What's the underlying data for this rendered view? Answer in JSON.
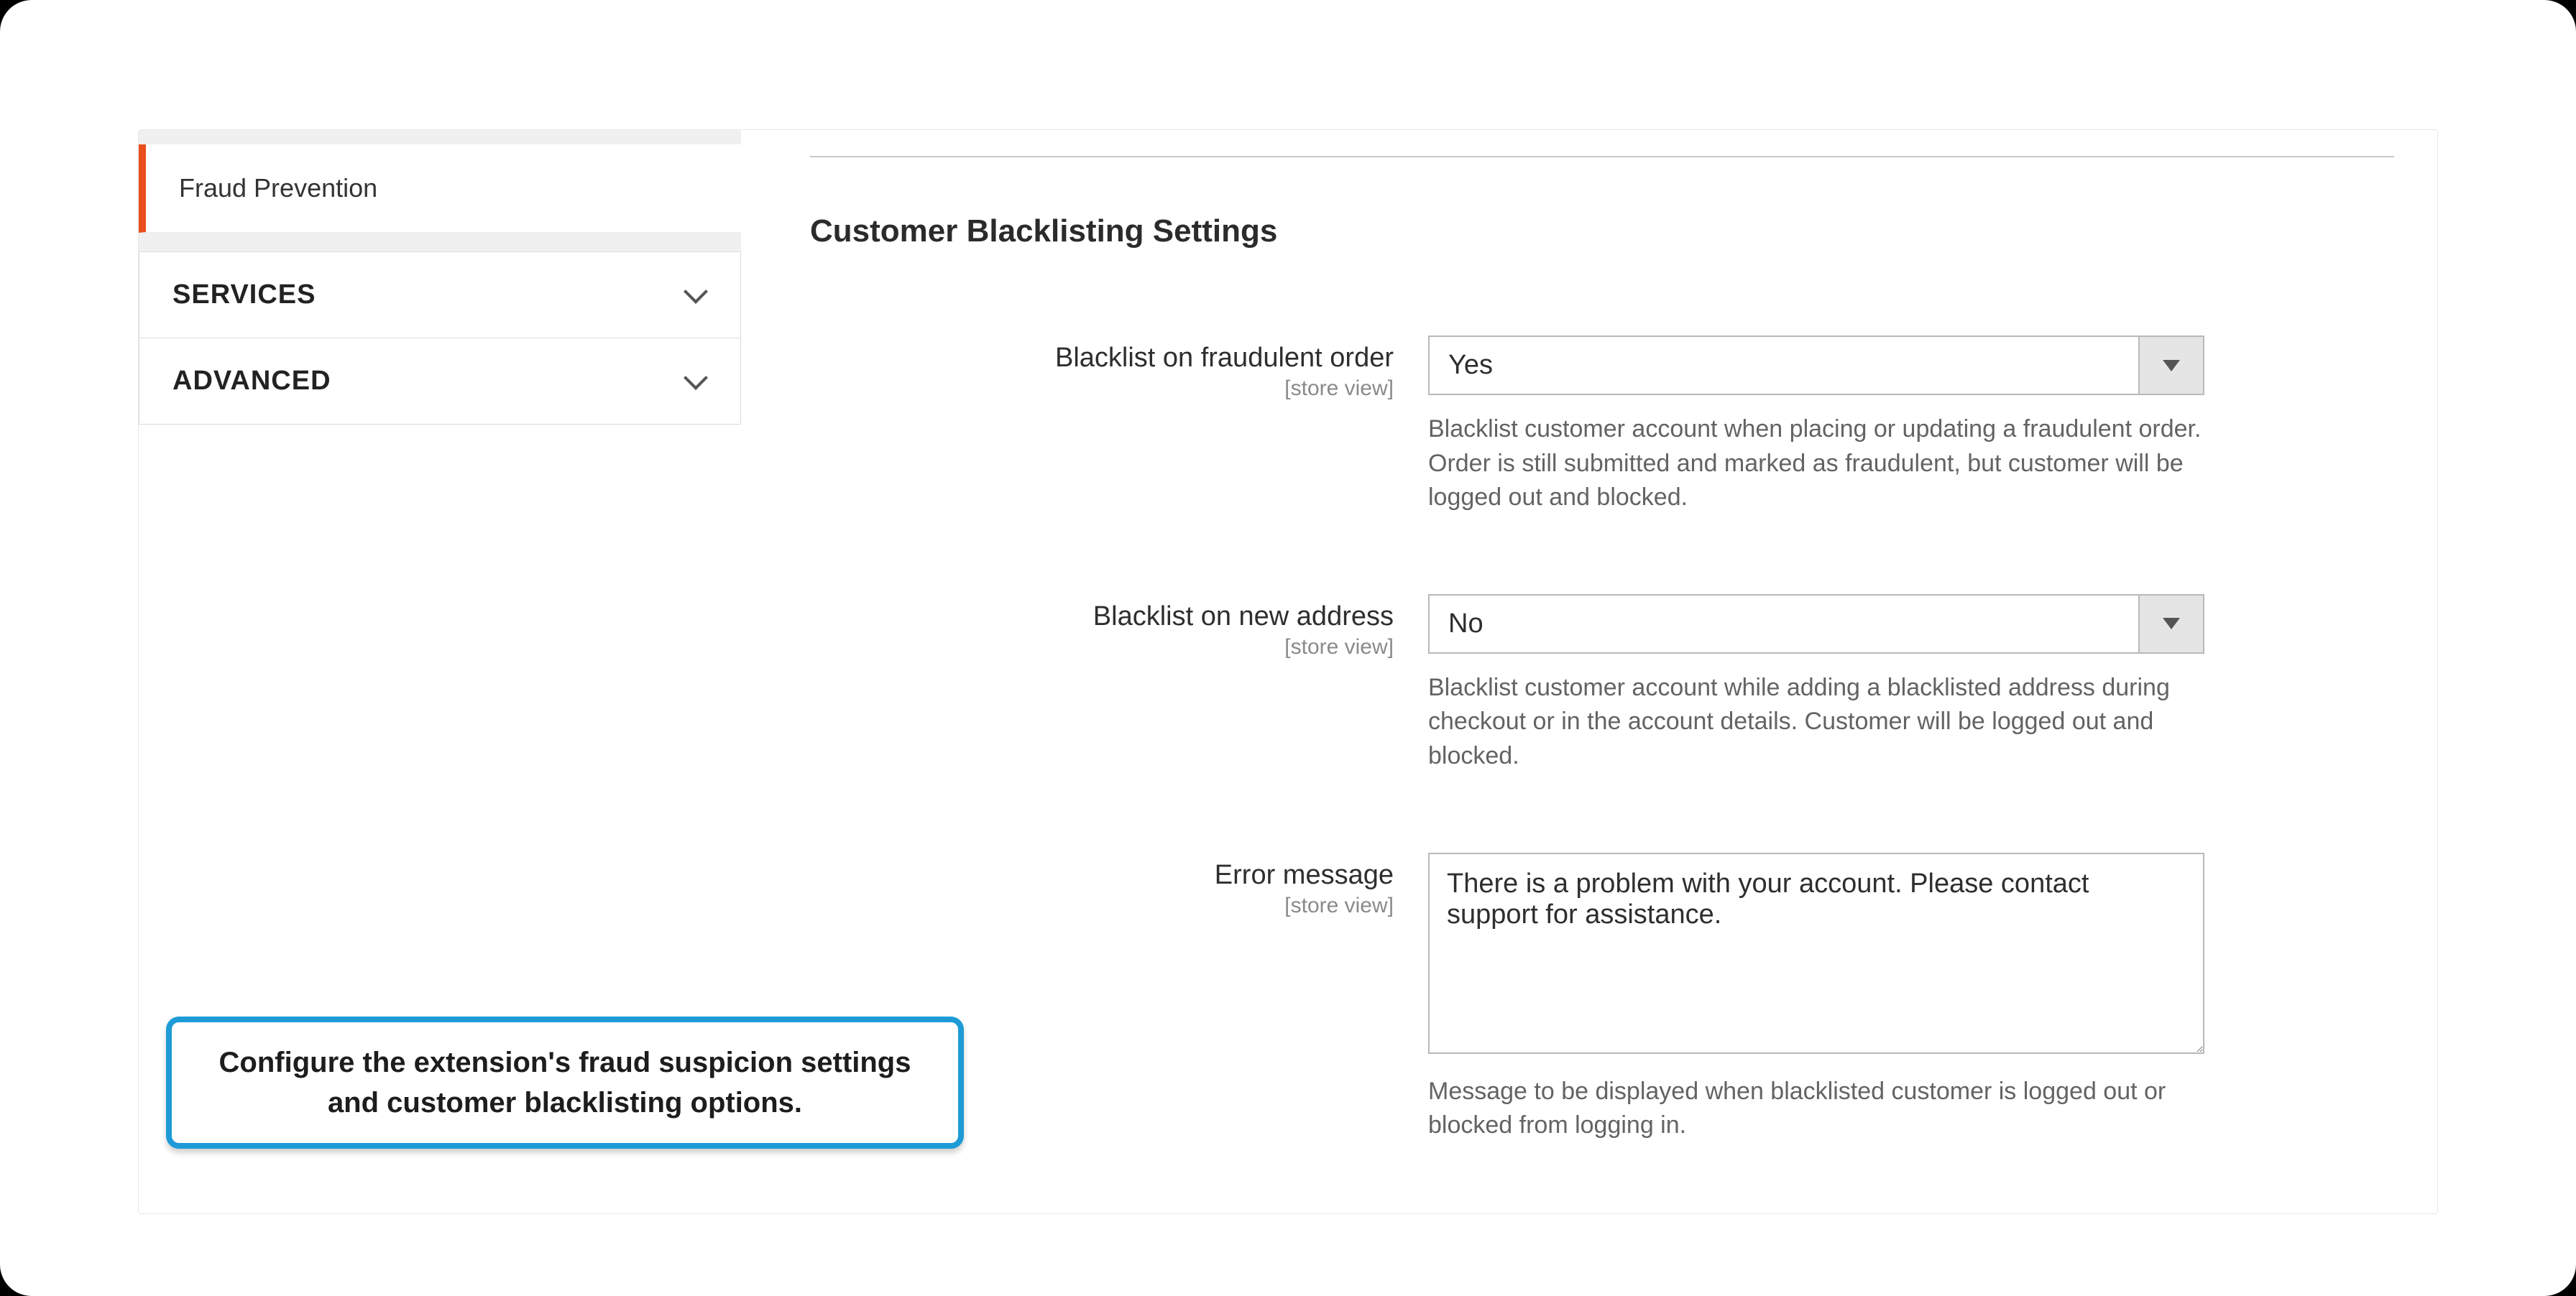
{
  "sidebar": {
    "active_tab": "Fraud Prevention",
    "groups": [
      {
        "label": "SERVICES"
      },
      {
        "label": "ADVANCED"
      }
    ]
  },
  "callout": {
    "text": "Configure the extension's fraud suspicion settings and customer blacklisting options."
  },
  "main": {
    "section_title": "Customer Blacklisting Settings",
    "scope_label": "[store view]",
    "fields": {
      "fraud_order": {
        "label": "Blacklist on fraudulent order",
        "value": "Yes",
        "help": "Blacklist customer account when placing or updating a fraudulent order. Order is still submitted and marked as fraudulent, but customer will be logged out and blocked."
      },
      "new_address": {
        "label": "Blacklist on new address",
        "value": "No",
        "help": "Blacklist customer account while adding a blacklisted address during checkout or in the account details. Customer will be logged out and blocked."
      },
      "error_message": {
        "label": "Error message",
        "value": "There is a problem with your account. Please contact support for assistance.",
        "help": "Message to be displayed when blacklisted customer is logged out or blocked from logging in."
      }
    }
  }
}
